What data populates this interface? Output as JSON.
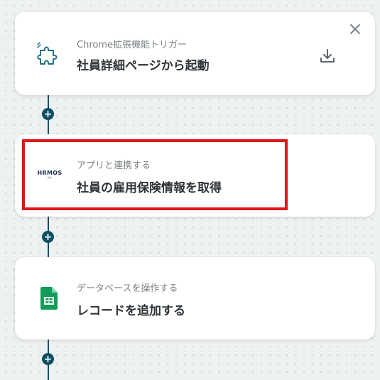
{
  "steps": [
    {
      "subtitle": "Chrome拡張機能トリガー",
      "title": "社員詳細ページから起動",
      "icon": "puzzle-piece-icon"
    },
    {
      "subtitle": "アプリと連携する",
      "title": "社員の雇用保険情報を取得",
      "icon": "hrmos-logo",
      "logo_text": "HRMOS",
      "logo_subtext": "勤怠"
    },
    {
      "subtitle": "データベースを操作する",
      "title": "レコードを追加する",
      "icon": "google-sheets-icon"
    }
  ],
  "add_button_symbol": "+",
  "colors": {
    "connector": "#0f4f66",
    "highlight": "#e0161b",
    "icon_teal": "#1f6f86",
    "sheets_green": "#0f9d58"
  }
}
